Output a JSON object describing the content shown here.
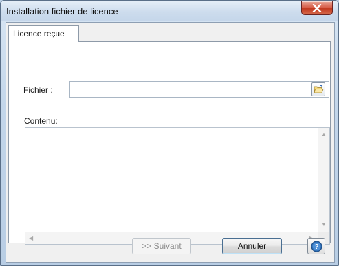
{
  "window": {
    "title": "Installation fichier de licence"
  },
  "tabs": [
    {
      "label": "Licence reçue",
      "selected": true
    }
  ],
  "form": {
    "file_label": "Fichier :",
    "file_value": "",
    "content_label": "Contenu:",
    "content_value": ""
  },
  "buttons": {
    "next_label": ">> Suivant",
    "next_enabled": false,
    "cancel_label": "Annuler"
  },
  "icons": {
    "close": "close-icon",
    "browse": "folder-open-icon",
    "help": "help-icon"
  },
  "colors": {
    "close_button": "#c1391f",
    "help_icon": "#2f6fb5",
    "folder_icon": "#e8c24a"
  }
}
